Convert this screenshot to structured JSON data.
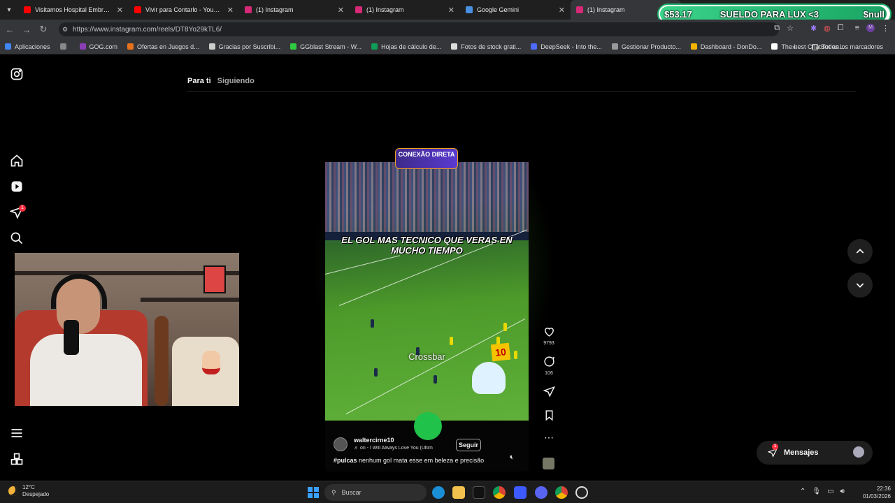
{
  "browser": {
    "tabs": [
      {
        "title": "Visitamos Hospital Embrujado c",
        "favicon_color": "#ff0000",
        "active": false
      },
      {
        "title": "Vivir para Contarlo - YouTube",
        "favicon_color": "#ff0000",
        "active": false
      },
      {
        "title": "(1) Instagram",
        "favicon_color": "#d62976",
        "active": false
      },
      {
        "title": "(1) Instagram",
        "favicon_color": "#d62976",
        "active": false
      },
      {
        "title": "Google Gemini",
        "favicon_color": "#4a90e2",
        "active": false
      },
      {
        "title": "(1) Instagram",
        "favicon_color": "#d62976",
        "active": true
      }
    ],
    "url": "https://www.instagram.com/reels/DT8Yo29kTL6/",
    "bookmarks": [
      {
        "label": "Aplicaciones",
        "color": "#4285f4"
      },
      {
        "label": "",
        "color": "#888888"
      },
      {
        "label": "GOG.com",
        "color": "#8a3fb5"
      },
      {
        "label": "Ofertas en Juegos d...",
        "color": "#e8721c"
      },
      {
        "label": "Gracias por Suscribi...",
        "color": "#cccccc"
      },
      {
        "label": "GGblast Stream - W...",
        "color": "#2ecc40"
      },
      {
        "label": "Hojas de cálculo de...",
        "color": "#0f9d58"
      },
      {
        "label": "Fotos de stock grati...",
        "color": "#dddddd"
      },
      {
        "label": "DeepSeek - Into the...",
        "color": "#4d6bfe"
      },
      {
        "label": "Gestionar Producto...",
        "color": "#999999"
      },
      {
        "label": "Dashboard - DonDo...",
        "color": "#f4b400"
      },
      {
        "label": "The best ChatBot an...",
        "color": "#ffffff"
      }
    ],
    "bookmarks_all": "Todos los marcadores"
  },
  "donation": {
    "amount": "$53.17",
    "goal_label": "SUELDO PARA LUX <3",
    "right_text": "$null"
  },
  "instagram": {
    "feed_tabs": [
      "Para ti",
      "Siguiendo"
    ],
    "sidebar_notification_count": "1",
    "reel": {
      "overlay_brand": "CONEXÃO DIRETA",
      "caption_text": "EL GOL MAS TECNICO QUE VERAS EN MUCHO TIEMPO",
      "crossbar_label": "Crossbar",
      "badge_number": "10",
      "username": "waltercirne10",
      "audio": "♬ on - I Will Always Love You (Ultim",
      "follow_label": "Seguir",
      "hashtag": "#pulcas",
      "description": " nenhum gol mata esse em beleza e precisão",
      "likes": "9793",
      "comments": "106"
    },
    "messages_label": "Mensajes",
    "messages_count": "1"
  },
  "taskbar": {
    "temperature": "12°C",
    "weather": "Despejado",
    "search_placeholder": "Buscar",
    "time": "22:36",
    "date": "01/03/2026"
  }
}
